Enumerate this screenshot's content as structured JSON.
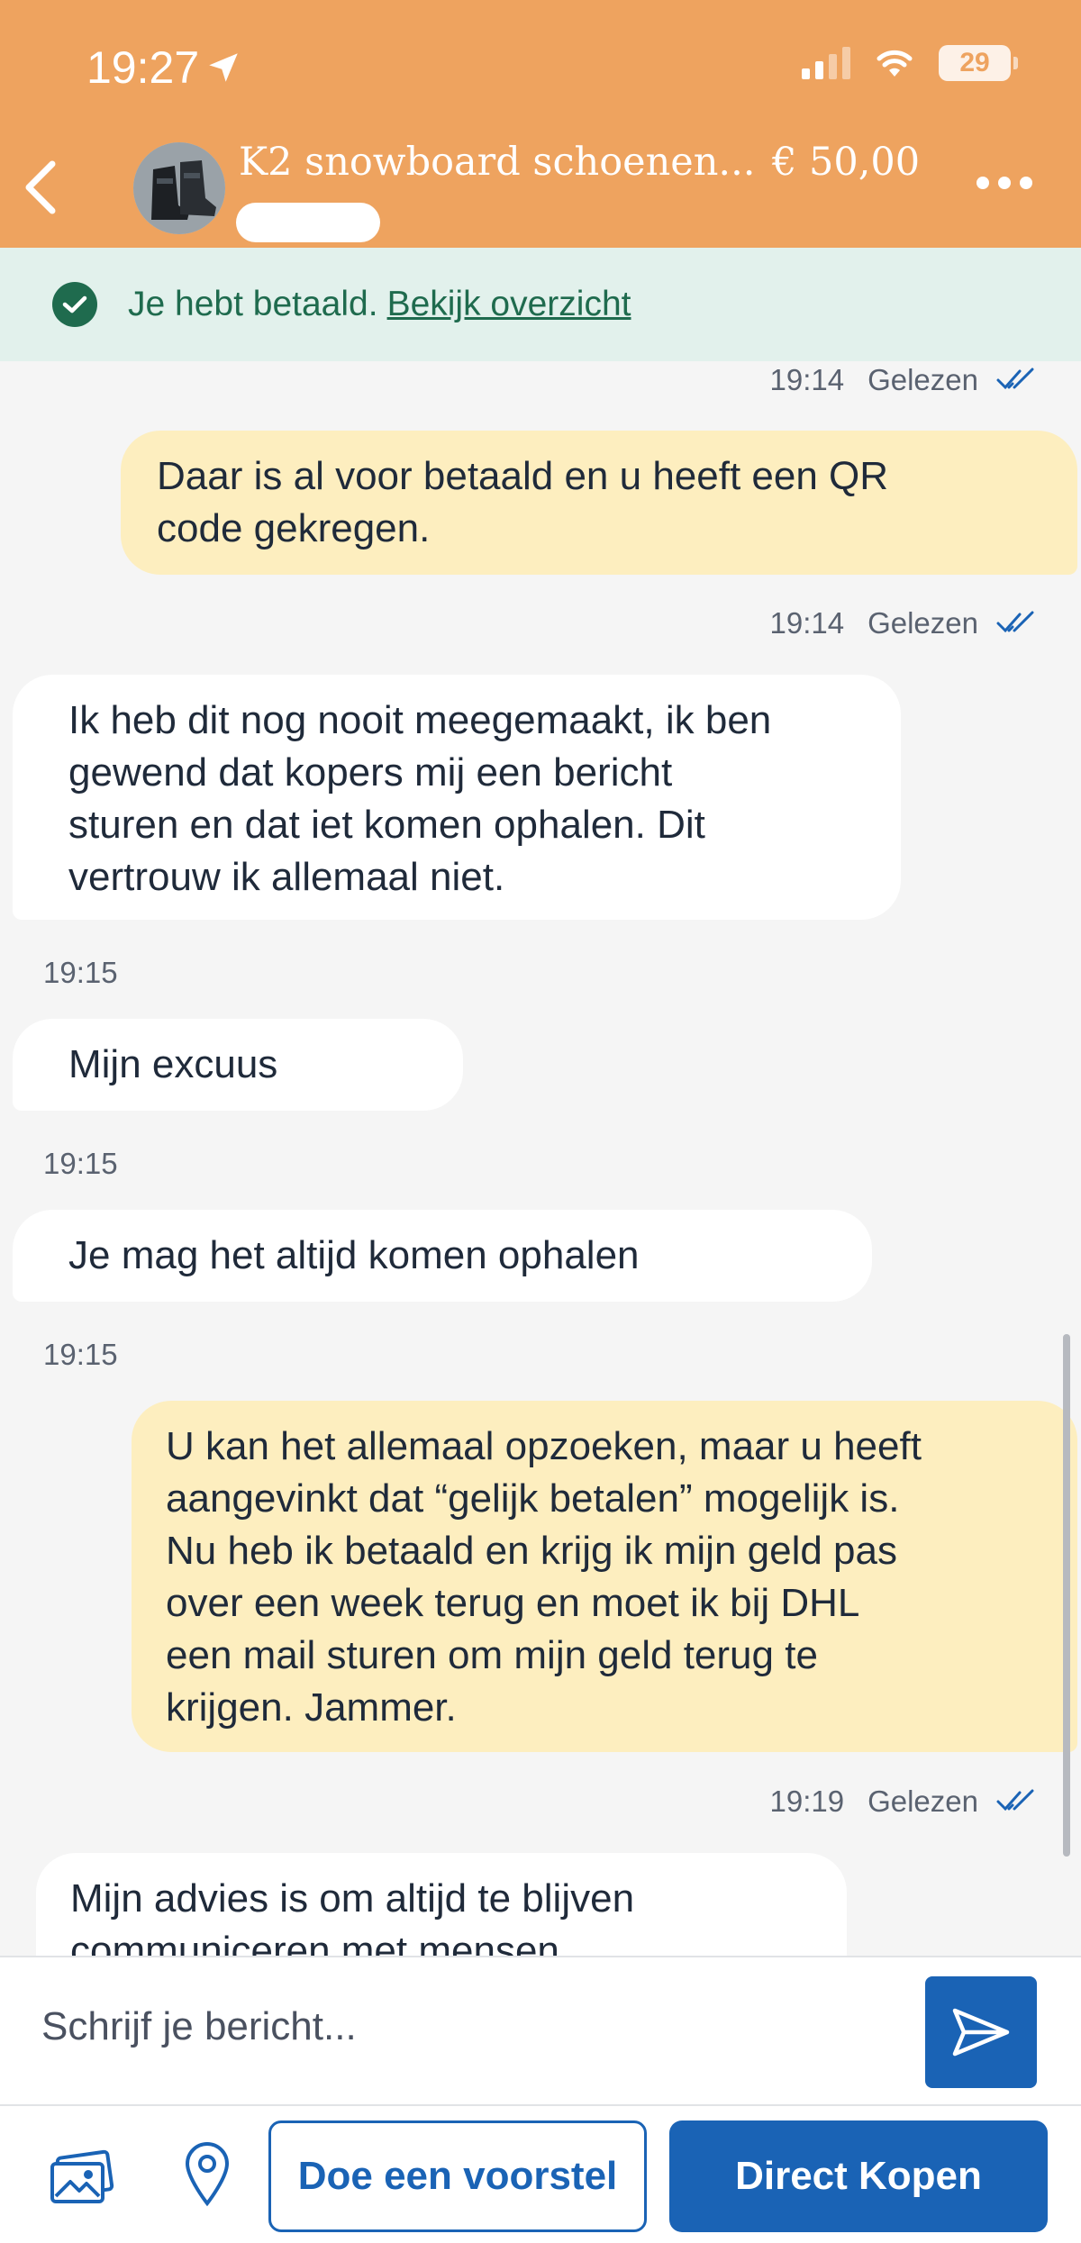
{
  "status_bar": {
    "time": "19:27",
    "battery": "29"
  },
  "header": {
    "product_title": "K2 snowboard schoenen...",
    "price": "€ 50,00",
    "icons": [
      "back-chevron-icon",
      "more-dots-icon"
    ]
  },
  "banner": {
    "text": "Je hebt betaald.",
    "link": "Bekijk overzicht"
  },
  "messages": [
    {
      "meta_time": "19:14",
      "meta_status": "Gelezen"
    },
    {
      "text": "Daar is al voor betaald en u heeft een QR\ncode gekregen.",
      "direction": "out"
    },
    {
      "meta_time": "19:14",
      "meta_status": "Gelezen"
    },
    {
      "text": "Ik heb dit nog nooit meegemaakt, ik ben\ngewend dat kopers mij een bericht\nsturen en dat iet komen ophalen. Dit\nvertrouw ik allemaal niet.",
      "direction": "in"
    },
    {
      "meta_time": "19:15"
    },
    {
      "text": "Mijn excuus",
      "direction": "in"
    },
    {
      "meta_time": "19:15"
    },
    {
      "text": "Je mag het altijd komen ophalen",
      "direction": "in"
    },
    {
      "meta_time": "19:15"
    },
    {
      "text": "U kan het allemaal opzoeken, maar u heeft\naangevinkt dat “gelijk betalen” mogelijk is.\nNu heb ik betaald en krijg ik mijn geld pas\nover een week terug en moet ik bij DHL\neen mail sturen om mijn geld terug te\nkrijgen. Jammer.",
      "direction": "out"
    },
    {
      "meta_time": "19:19",
      "meta_status": "Gelezen"
    },
    {
      "text": "Mijn advies is om altijd te blijven\ncommuniceren met mensen",
      "direction": "in"
    }
  ],
  "composer": {
    "placeholder": "Schrijf je bericht..."
  },
  "actions": {
    "offer_label": "Doe een voorstel",
    "buy_label": "Direct Kopen"
  },
  "colors": {
    "header": "#eea35f",
    "banner": "#e2f1ec",
    "accent": "#1a63b5",
    "out_bubble": "#fdeebf"
  }
}
